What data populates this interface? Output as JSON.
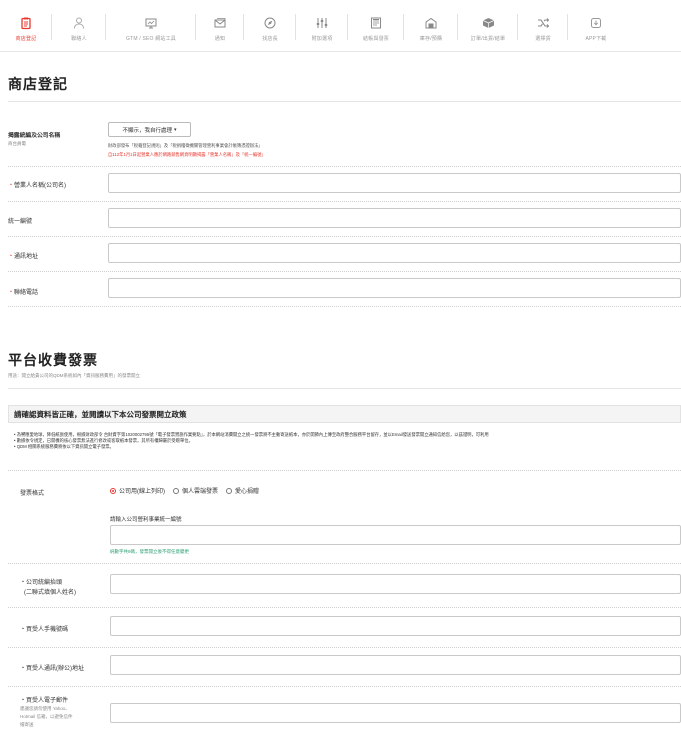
{
  "nav": {
    "items": [
      {
        "label": "商店登記",
        "icon": "store-clipboard-icon",
        "active": true
      },
      {
        "label": "聯絡人",
        "icon": "person-icon",
        "active": false
      },
      {
        "label": "GTM / SEO 網站工具",
        "icon": "monitor-icon",
        "active": false
      },
      {
        "label": "通知",
        "icon": "envelope-icon",
        "active": false
      },
      {
        "label": "找店長",
        "icon": "compass-icon",
        "active": false
      },
      {
        "label": "附加選項",
        "icon": "sliders-icon",
        "active": false
      },
      {
        "label": "結帳與發票",
        "icon": "invoice-icon",
        "active": false
      },
      {
        "label": "庫存/預購",
        "icon": "warehouse-icon",
        "active": false
      },
      {
        "label": "訂單/出貨/結單",
        "icon": "box-package-icon",
        "active": false
      },
      {
        "label": "選擇貨",
        "icon": "shuffle-icon",
        "active": false
      },
      {
        "label": "APP下載",
        "icon": "app-download-icon",
        "active": false
      }
    ],
    "active_color": "#e8382f"
  },
  "store": {
    "title": "商店登記",
    "display_label": "揭露統編及公司名稱",
    "display_sublabel": "商台員電",
    "display_select": "不顯示，我自行處理",
    "display_note_1": "財政部發布「稅籍登記規則」及「稅捐稽徵機關管理營利事業會計帳簿憑證辦法」",
    "display_note_2": "自112年1月1日起營業人應於網路銷售網頁明顯揭露「營業人名稱」及「統一編號」",
    "fields": [
      {
        "label": "營業人名稱(公司名)",
        "required": true,
        "value": ""
      },
      {
        "label": "統一編號",
        "required": false,
        "value": ""
      },
      {
        "label": "通訊地址",
        "required": true,
        "value": ""
      },
      {
        "label": "聯絡電話",
        "required": true,
        "value": ""
      }
    ]
  },
  "platform": {
    "title": "平台收費發票",
    "subtitle": "用途：開立給貴公司的QDM系統如內「資訊服務費用」的發票開立",
    "policy_title": "請確認資料皆正確，並閱讀以下本公司發票開立政策",
    "policy_lines": [
      "為響應愛地球，降低紙張使用，根據財政部令 台財資字第1020002795號「電子發票實施作業要點」，於本網站消費開立之統一發票將不主動寄送紙本，亦於開節內上傳至政府整合服務平台留存，並以Email發送發票開立通知信給您，以茲證明，可利用",
      "數據依令規定，已開機的核心發票無法進行修改或客取紙本發票，其所有權歸屬於受贈單位。",
      "QDM 相關系統服務費將依以下資訊開立電子發票。"
    ],
    "invoice_format_label": "發票格式",
    "invoice_options": [
      "公司用(線上列印)",
      "個人雲端發票",
      "愛心捐贈"
    ],
    "invoice_selected": "公司用(線上列印)",
    "tax_id_caption": "請輸入公司營利事業統一編號",
    "tax_id_hint": "純數字共8碼，發票開立後不得任意變更",
    "fields": [
      {
        "label": "公司統編抬頭",
        "sub": "(二聯式填個人姓名)",
        "value": ""
      },
      {
        "label": "買受人手機號碼",
        "sub": "",
        "value": ""
      },
      {
        "label": "買受人通訊(辦公)地址",
        "sub": "",
        "value": ""
      },
      {
        "label": "買受人電子郵件",
        "sub": "",
        "value": ""
      }
    ],
    "email_note": "建議您請勿使用 Yahoo、Hotmail 信箱，以避免信件擋寄送"
  }
}
